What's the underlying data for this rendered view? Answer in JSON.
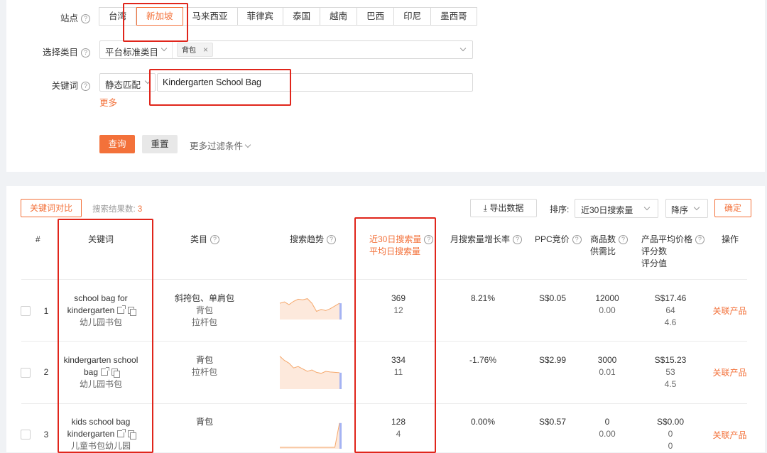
{
  "filters": {
    "site_label": "站点",
    "sites": [
      "台湾",
      "新加坡",
      "马来西亚",
      "菲律宾",
      "泰国",
      "越南",
      "巴西",
      "印尼",
      "墨西哥"
    ],
    "category_label": "选择类目",
    "category_type": "平台标准类目",
    "category_tag": "背包",
    "keyword_label": "关键词",
    "match_type": "静态匹配",
    "keyword_value": "Kindergarten School Bag",
    "more_link": "更多",
    "query_button": "查询",
    "reset_button": "重置",
    "more_filters": "更多过滤条件"
  },
  "toolbar": {
    "compare_button": "关键词对比",
    "result_label": "搜索结果数:",
    "result_count": "3",
    "export_button": "导出数据",
    "sort_label": "排序:",
    "sort_value": "近30日搜索量",
    "order_value": "降序",
    "confirm_button": "确定"
  },
  "table": {
    "headers": {
      "index": "#",
      "keyword": "关键词",
      "category": "类目",
      "trend": "搜索趋势",
      "search30_line1": "近30日搜索量",
      "search30_line2": "平均日搜索量",
      "growth": "月搜索量增长率",
      "ppc": "PPC竞价",
      "supply_line1": "商品数",
      "supply_line2": "供需比",
      "price_line1": "产品平均价格",
      "price_line2": "评分数",
      "price_line3": "评分值",
      "action": "操作"
    },
    "rows": [
      {
        "index": "1",
        "kw_line1": "school bag for",
        "kw_line2": "kindergarten",
        "kw_cn": "幼儿园书包",
        "cat1": "斜挎包、单肩包",
        "cat2": "背包",
        "cat3": "拉杆包",
        "search30": "369",
        "daily": "12",
        "growth": "8.21%",
        "ppc": "S$0.05",
        "products": "12000",
        "ratio": "0.00",
        "price": "S$17.46",
        "reviews": "64",
        "rating": "4.6",
        "action": "关联产品",
        "trend": [
          0.55,
          0.6,
          0.5,
          0.62,
          0.7,
          0.68,
          0.72,
          0.55,
          0.25,
          0.32,
          0.28,
          0.35,
          0.45,
          0.55
        ]
      },
      {
        "index": "2",
        "kw_line1": "kindergarten school",
        "kw_line2": "bag",
        "kw_cn": "幼儿园书包",
        "cat1": "背包",
        "cat2": "拉杆包",
        "cat3": "",
        "search30": "334",
        "daily": "11",
        "growth": "-1.76%",
        "ppc": "S$2.99",
        "products": "3000",
        "ratio": "0.01",
        "price": "S$15.23",
        "reviews": "53",
        "rating": "4.5",
        "action": "关联产品",
        "trend": [
          0.92,
          0.8,
          0.72,
          0.58,
          0.62,
          0.55,
          0.48,
          0.52,
          0.45,
          0.42,
          0.48,
          0.46,
          0.45,
          0.44
        ]
      },
      {
        "index": "3",
        "kw_line1": "kids school bag",
        "kw_line2": "kindergarten",
        "kw_cn": "儿童书包幼儿园",
        "cat1": "背包",
        "cat2": "",
        "cat3": "",
        "search30": "128",
        "daily": "4",
        "growth": "0.00%",
        "ppc": "S$0.57",
        "products": "0",
        "ratio": "0.00",
        "price": "S$0.00",
        "reviews": "0",
        "rating": "0",
        "action": "关联产品",
        "trend": [
          0.0,
          0.0,
          0.0,
          0.0,
          0.0,
          0.0,
          0.0,
          0.0,
          0.0,
          0.0,
          0.0,
          0.0,
          0.0,
          0.95
        ]
      }
    ]
  },
  "colors": {
    "accent": "#f3713a",
    "highlight_box": "#e0251b",
    "trend_line": "#f5a86c",
    "trend_tail": "#8ea0f0"
  }
}
